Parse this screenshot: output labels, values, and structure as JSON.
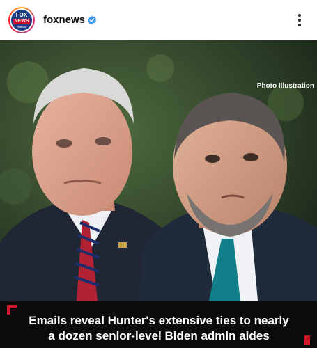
{
  "post": {
    "account_name": "foxnews",
    "verified": true,
    "avatar": {
      "brand_text_top": "FOX",
      "brand_text_bottom": "NEWS",
      "brand_text_channel": "channel"
    },
    "photo_credit": "Photo Illustration",
    "caption_line1": "Emails reveal Hunter's extensive ties to nearly",
    "caption_line2": "a dozen senior-level Biden admin aides"
  },
  "colors": {
    "brand_blue": "#1b3f87",
    "brand_red": "#c8102e",
    "verified_blue": "#3897f0",
    "accent_red": "#d0172a"
  },
  "icons": {
    "verified": "verified-badge-icon",
    "more": "more-options-icon"
  }
}
